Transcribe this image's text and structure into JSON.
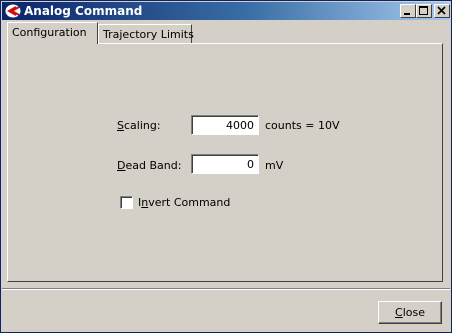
{
  "window": {
    "title": "Analog Command",
    "controls": {
      "minimize_icon": "minimize-icon",
      "maximize_icon": "maximize-icon",
      "close_icon": "close-icon"
    }
  },
  "tabs": [
    {
      "label": "Configuration",
      "selected": true
    },
    {
      "label": "Trajectory Limits",
      "selected": false
    }
  ],
  "form": {
    "scaling": {
      "label_mnemonic": "S",
      "label_rest": "caling:",
      "value": "4000",
      "unit": "counts = 10V"
    },
    "dead_band": {
      "label_mnemonic": "D",
      "label_rest": "ead Band:",
      "value": "0",
      "unit": "mV"
    },
    "invert": {
      "label_pre": "I",
      "label_mnemonic": "n",
      "label_rest": "vert Command",
      "checked": false
    }
  },
  "footer": {
    "close_mnemonic": "C",
    "close_rest": "lose"
  },
  "colors": {
    "title_start": "#0a246a",
    "title_end": "#a6caf0",
    "face": "#d4d0c8"
  }
}
